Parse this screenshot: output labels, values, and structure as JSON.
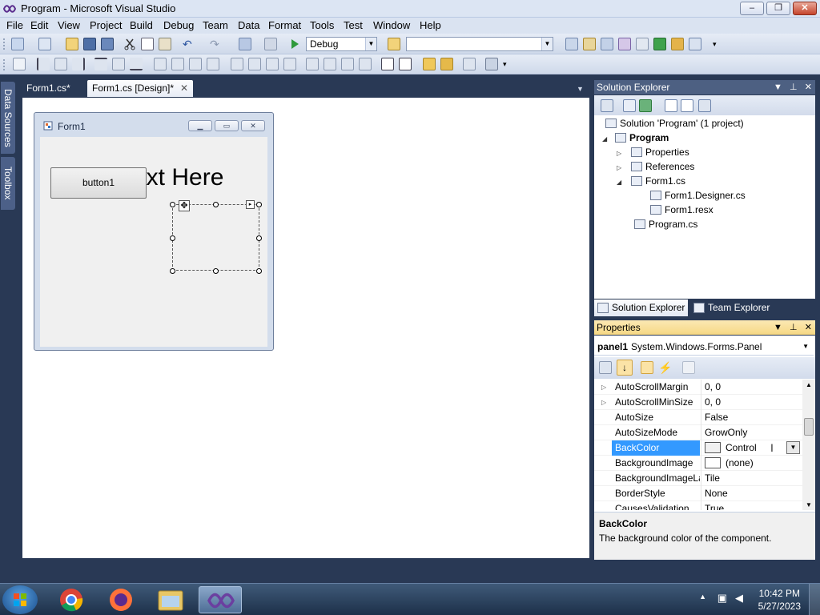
{
  "window": {
    "title": "Program - Microsoft Visual Studio",
    "min_label": "–",
    "max_label": "❐",
    "close_label": "✕"
  },
  "menu": [
    "File",
    "Edit",
    "View",
    "Project",
    "Build",
    "Debug",
    "Team",
    "Data",
    "Format",
    "Tools",
    "Test",
    "Window",
    "Help"
  ],
  "toolbar": {
    "config_value": "Debug",
    "platform_value": ""
  },
  "side_tabs": [
    "Data Sources",
    "Toolbox"
  ],
  "doc_tabs": [
    {
      "label": "Form1.cs*"
    },
    {
      "label": "Form1.cs [Design]*",
      "close": "✕"
    }
  ],
  "designer": {
    "form_title": "Form1",
    "button_label": "button1",
    "label_text": "ext Here"
  },
  "solution_explorer": {
    "title": "Solution Explorer",
    "items": [
      {
        "label": "Solution 'Program' (1 project)",
        "expander": ""
      },
      {
        "label": "Program",
        "expander": "◢"
      },
      {
        "label": "Properties",
        "expander": "▷"
      },
      {
        "label": "References",
        "expander": "▷"
      },
      {
        "label": "Form1.cs",
        "expander": "◢"
      },
      {
        "label": "Form1.Designer.cs",
        "expander": ""
      },
      {
        "label": "Form1.resx",
        "expander": ""
      },
      {
        "label": "Program.cs",
        "expander": ""
      }
    ],
    "tabs": [
      "Solution Explorer",
      "Team Explorer"
    ]
  },
  "properties": {
    "title": "Properties",
    "object_name": "panel1",
    "object_type": "System.Windows.Forms.Panel",
    "rows": [
      {
        "name": "AutoScrollMargin",
        "value": "0, 0",
        "expander": "▷"
      },
      {
        "name": "AutoScrollMinSize",
        "value": "0, 0",
        "expander": "▷"
      },
      {
        "name": "AutoSize",
        "value": "False",
        "expander": ""
      },
      {
        "name": "AutoSizeMode",
        "value": "GrowOnly",
        "expander": ""
      },
      {
        "name": "BackColor",
        "value": "Control",
        "expander": ""
      },
      {
        "name": "BackgroundImage",
        "value": "(none)",
        "expander": ""
      },
      {
        "name": "BackgroundImageLayout",
        "value": "Tile",
        "expander": ""
      },
      {
        "name": "BorderStyle",
        "value": "None",
        "expander": ""
      },
      {
        "name": "CausesValidation",
        "value": "True",
        "expander": ""
      }
    ],
    "desc_title": "BackColor",
    "desc_text": "The background color of the component."
  },
  "taskbar": {
    "time": "10:42 PM",
    "date": "5/27/2023"
  },
  "colors": {
    "chrome": "#293955",
    "selection": "#3399ff",
    "active_header": "#f6d883"
  }
}
